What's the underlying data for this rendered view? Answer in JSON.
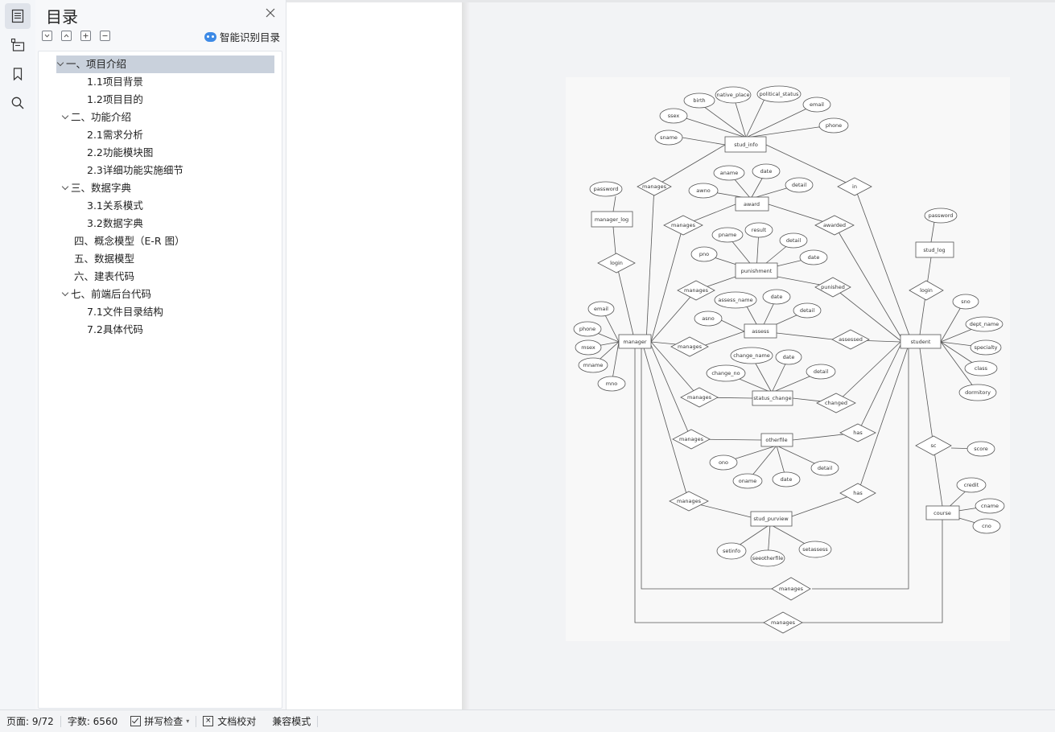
{
  "toc": {
    "title": "目录",
    "smart_label": "智能识别目录",
    "items": [
      {
        "label": "一、项目介绍"
      },
      {
        "label": "1.1项目背景"
      },
      {
        "label": "1.2项目目的"
      },
      {
        "label": "二、功能介绍"
      },
      {
        "label": "2.1需求分析"
      },
      {
        "label": "2.2功能模块图"
      },
      {
        "label": "2.3详细功能实施细节"
      },
      {
        "label": "三、数据字典"
      },
      {
        "label": "3.1关系模式"
      },
      {
        "label": "3.2数据字典"
      },
      {
        "label": "四、概念模型（E-R 图）"
      },
      {
        "label": "五、数据模型"
      },
      {
        "label": "六、建表代码"
      },
      {
        "label": "七、前端后台代码"
      },
      {
        "label": "7.1文件目录结构"
      },
      {
        "label": "7.2具体代码"
      }
    ]
  },
  "diagram": {
    "entities": [
      "stud_info",
      "award",
      "manager_log",
      "punishment",
      "stud_log",
      "assess",
      "manager",
      "student",
      "status_change",
      "otherfile",
      "course",
      "stud_purview"
    ],
    "relations": [
      "manages",
      "in",
      "manages",
      "awarded",
      "login",
      "manages",
      "punished",
      "login",
      "manages",
      "assessed",
      "manages",
      "changed",
      "has",
      "manages",
      "sc",
      "manages",
      "has",
      "manages",
      "manages"
    ],
    "attributes": [
      "birth",
      "native_place",
      "political_status",
      "ssex",
      "email",
      "phone",
      "sname",
      "aname",
      "date",
      "awno",
      "detail",
      "password",
      "pname",
      "result",
      "detail",
      "password",
      "pno",
      "date",
      "assess_name",
      "date",
      "sno",
      "email",
      "asno",
      "detail",
      "dept_name",
      "phone",
      "specialty",
      "msex",
      "change_name",
      "date",
      "class",
      "mname",
      "change_no",
      "detail",
      "mno",
      "dormitory",
      "score",
      "ono",
      "detail",
      "oname",
      "date",
      "credit",
      "cname",
      "cno",
      "setinfo",
      "setassess",
      "seeotherfile"
    ]
  },
  "status": {
    "page": "页面: 9/72",
    "words": "字数: 6560",
    "spell": "拼写检查",
    "proof": "文档校对",
    "compat": "兼容模式"
  }
}
